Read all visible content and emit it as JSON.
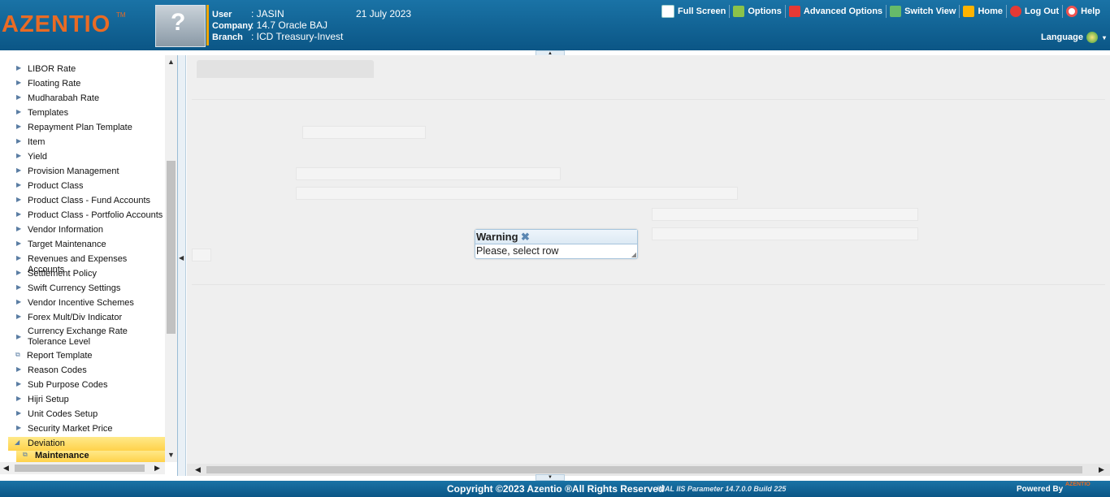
{
  "header": {
    "logo_text": "AZENTIO",
    "logo_tm": "TM",
    "user_label": "User",
    "user_value": ": JASIN",
    "company_label": "Company",
    "company_value": ": 14.7 Oracle BAJ",
    "branch_label": "Branch",
    "branch_value": ": ICD Treasury-Invest",
    "date": "21 July 2023",
    "links": [
      {
        "label": "Full Screen",
        "icon": "fullscreen-icon",
        "color": "#ffffff"
      },
      {
        "label": "Options",
        "icon": "download-arrow-icon",
        "color": "#8bc34a"
      },
      {
        "label": "Advanced Options",
        "icon": "tools-icon",
        "color": "#e53935"
      },
      {
        "label": "Switch View",
        "icon": "switch-view-icon",
        "color": "#66bb6a"
      },
      {
        "label": "Home",
        "icon": "home-icon",
        "color": "#ffb300"
      },
      {
        "label": "Log Out",
        "icon": "power-icon",
        "color": "#e53935"
      },
      {
        "label": "Help",
        "icon": "lifebuoy-icon",
        "color": "#ef5350"
      }
    ],
    "language_label": "Language"
  },
  "sidebar": {
    "items": [
      {
        "label": "LIBOR Rate"
      },
      {
        "label": "Floating Rate"
      },
      {
        "label": "Mudharabah Rate"
      },
      {
        "label": "Templates"
      },
      {
        "label": "Repayment Plan Template"
      },
      {
        "label": "Item"
      },
      {
        "label": "Yield"
      },
      {
        "label": "Provision Management"
      },
      {
        "label": "Product Class"
      },
      {
        "label": "Product Class - Fund Accounts"
      },
      {
        "label": "Product Class - Portfolio Accounts"
      },
      {
        "label": "Vendor Information"
      },
      {
        "label": "Target Maintenance"
      },
      {
        "label": "Revenues and Expenses Accounts"
      },
      {
        "label": "Settlement Policy"
      },
      {
        "label": "Swift Currency Settings"
      },
      {
        "label": "Vendor Incentive Schemes"
      },
      {
        "label": "Forex Mult/Div Indicator"
      },
      {
        "label": "Currency Exchange Rate Tolerance Level"
      },
      {
        "label": "Report Template"
      },
      {
        "label": "Reason Codes"
      },
      {
        "label": "Sub Purpose Codes"
      },
      {
        "label": "Hijri Setup"
      },
      {
        "label": "Unit Codes Setup"
      },
      {
        "label": "Security Market Price"
      },
      {
        "label": "Deviation"
      },
      {
        "label": "Maintenance"
      }
    ]
  },
  "dialog": {
    "title": "Warning",
    "message": "Please, select row"
  },
  "footer": {
    "copyright": "Copyright ©2023 Azentio ®All Rights Reserved",
    "build": "iMAL IIS Parameter 14.7.0.0 Build 225",
    "powered_by": "Powered By",
    "powered_logo": "AZENTIO"
  }
}
